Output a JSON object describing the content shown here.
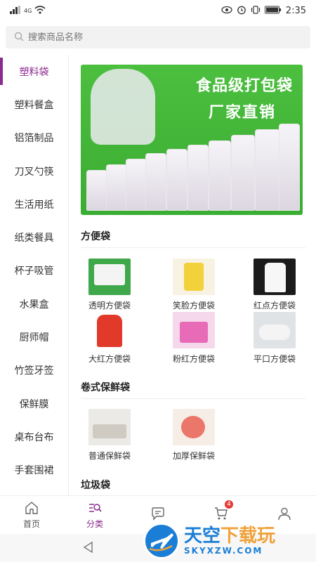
{
  "status_bar": {
    "signal_label": "4G",
    "time": "2:35"
  },
  "search": {
    "placeholder": "搜索商品名称"
  },
  "sidebar": {
    "items": [
      {
        "label": "塑料袋",
        "active": true
      },
      {
        "label": "塑料餐盒"
      },
      {
        "label": "铝箔制品"
      },
      {
        "label": "刀叉勺筷"
      },
      {
        "label": "生活用纸"
      },
      {
        "label": "纸类餐具"
      },
      {
        "label": "杯子吸管"
      },
      {
        "label": "水果盒"
      },
      {
        "label": "厨师帽"
      },
      {
        "label": "竹签牙签"
      },
      {
        "label": "保鲜膜"
      },
      {
        "label": "桌布台布"
      },
      {
        "label": "手套围裙"
      }
    ]
  },
  "banner": {
    "line1": "食品级打包袋",
    "line2": "厂家直销"
  },
  "sections": [
    {
      "title": "方便袋",
      "products": [
        {
          "label": "透明方便袋",
          "icon": "clear-bag-image"
        },
        {
          "label": "笑脸方便袋",
          "icon": "smile-bag-image"
        },
        {
          "label": "红点方便袋",
          "icon": "red-dot-bag-image"
        },
        {
          "label": "大红方便袋",
          "icon": "big-red-bag-image"
        },
        {
          "label": "粉红方便袋",
          "icon": "pink-bag-image"
        },
        {
          "label": "平口方便袋",
          "icon": "flat-bag-image"
        }
      ]
    },
    {
      "title": "卷式保鲜袋",
      "products": [
        {
          "label": "普通保鲜袋",
          "icon": "roll-bag-image"
        },
        {
          "label": "加厚保鲜袋",
          "icon": "thick-bag-image"
        }
      ]
    },
    {
      "title": "垃圾袋",
      "products": []
    }
  ],
  "bottom_nav": {
    "items": [
      {
        "label": "首页",
        "icon": "home-icon"
      },
      {
        "label": "分类",
        "icon": "category-search-icon",
        "active": true
      },
      {
        "label": "",
        "icon": "message-icon"
      },
      {
        "label": "",
        "icon": "cart-icon",
        "badge": "4"
      },
      {
        "label": "",
        "icon": "user-icon"
      }
    ]
  },
  "watermark": {
    "cn_part1": "天空",
    "cn_part2": "下载玩",
    "en": "SKYXZW.COM"
  },
  "colors": {
    "accent": "#8b2a8f",
    "banner_green": "#3fae36",
    "badge_red": "#e53935",
    "watermark_blue": "#1a7ed6"
  }
}
